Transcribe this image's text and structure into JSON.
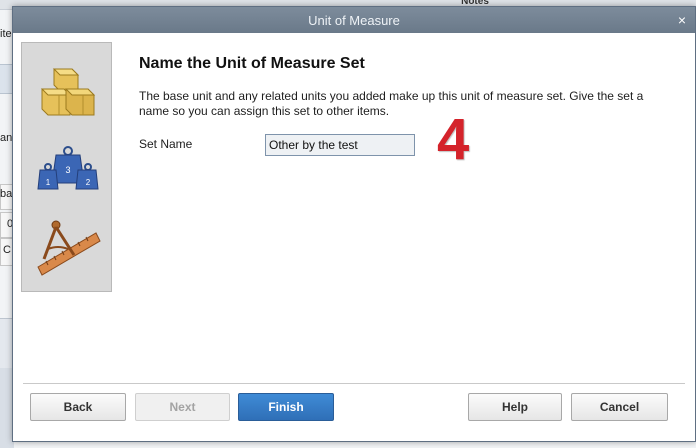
{
  "background": {
    "notes_header": "Notes",
    "edge_fragments": [
      "ite",
      "an",
      "ba",
      "0",
      "C"
    ]
  },
  "dialog": {
    "title": "Unit of Measure",
    "close_symbol": "×",
    "heading": "Name the Unit of Measure Set",
    "description": "The base unit and any related units you added make up this unit of measure set. Give the set a name so you can assign this set to other items.",
    "set_name_label": "Set Name",
    "set_name_value": "Other by the test",
    "step_number": "4",
    "icons": [
      "boxes-icon",
      "weights-icon",
      "ruler-compass-icon"
    ],
    "buttons": {
      "back": "Back",
      "next": "Next",
      "finish": "Finish",
      "help": "Help",
      "cancel": "Cancel"
    }
  },
  "colors": {
    "titlebar": "#7d8c9c",
    "finish_button": "#3f8bd6",
    "step_mark": "#d4232b"
  }
}
